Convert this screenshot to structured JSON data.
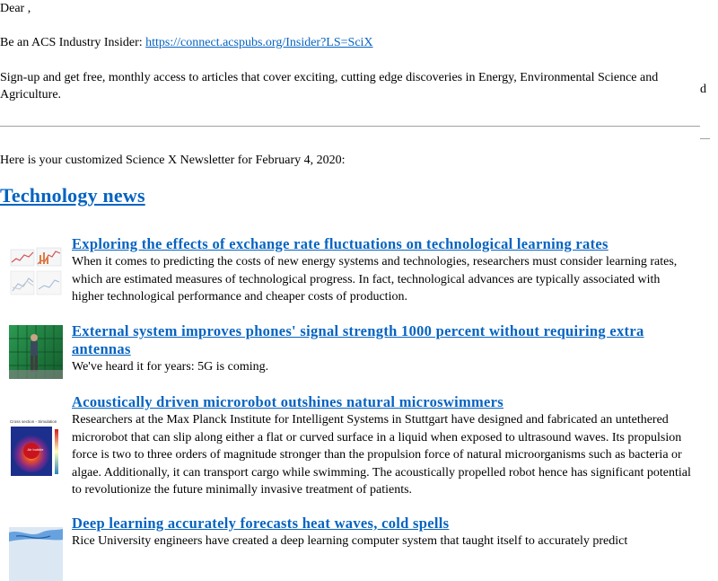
{
  "greeting": "Dear ,",
  "ad": {
    "lead": "Be an ACS Industry Insider: ",
    "link": "https://connect.acspubs.org/Insider?LS=SciX",
    "body": "Sign-up and get free, monthly access to articles that cover exciting, cutting edge discoveries in Energy, Environmental Science and Agriculture.",
    "side_char": "d"
  },
  "intro": "Here is your customized Science X Newsletter for February 4, 2020:",
  "section": {
    "title": "Technology news"
  },
  "articles": [
    {
      "title": "Exploring the effects of exchange rate fluctuations on technological learning rates",
      "body": "When it comes to predicting the costs of new energy systems and technologies, researchers must consider learning rates, which are estimated measures of technological progress. In fact, technological advances are typically associated with higher technological performance and cheaper costs of production.",
      "thumb_icon": "chart-thumbnail"
    },
    {
      "title": "External system improves phones' signal strength 1000 percent without requiring extra antennas",
      "body": "We've heard it for years: 5G is coming.",
      "thumb_icon": "person-lab-thumbnail"
    },
    {
      "title": "Acoustically driven microrobot outshines natural microswimmers",
      "body": "Researchers at the Max Planck Institute for Intelligent Systems in Stuttgart have designed and fabricated an untethered microrobot that can slip along either a flat or curved surface in a liquid when exposed to ultrasound waves. Its propulsion force is two to three orders of magnitude stronger than the propulsion force of natural microorganisms such as bacteria or algae. Additionally, it can transport cargo while swimming. The acoustically propelled robot hence has significant potential to revolutionize the future minimally invasive treatment of patients.",
      "thumb_icon": "microrobot-simulation-thumbnail",
      "thumb_caption": "Cross section - Simulation",
      "thumb_label": "Air bubble"
    },
    {
      "title": "Deep learning accurately forecasts heat waves, cold spells",
      "body": "Rice University engineers have created a deep learning computer system that taught itself to accurately predict",
      "thumb_icon": "weather-map-thumbnail"
    }
  ]
}
